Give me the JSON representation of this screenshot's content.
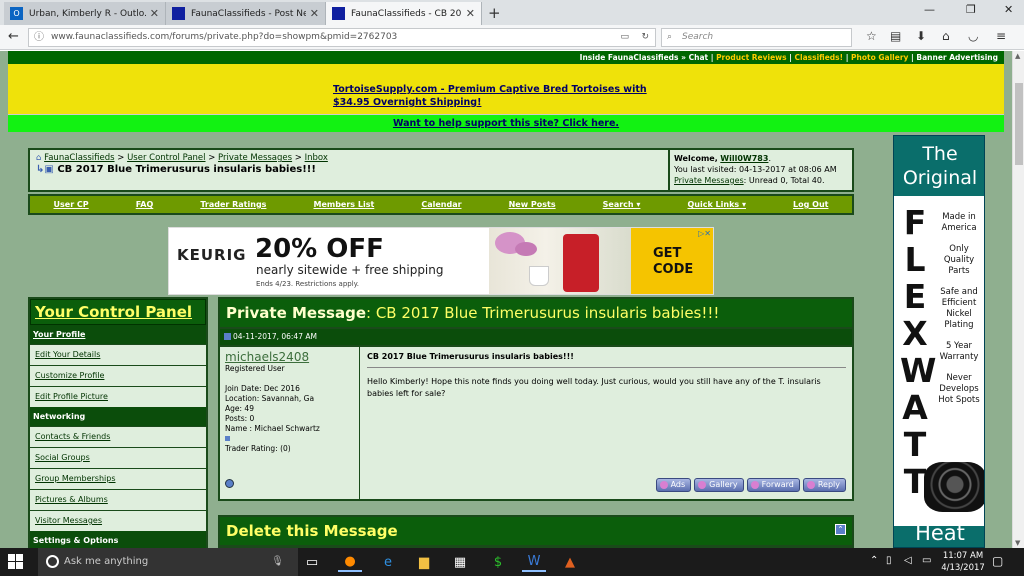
{
  "browser": {
    "tabs": [
      {
        "title": "Urban, Kimberly R - Outlo..."
      },
      {
        "title": "FaunaClassifieds - Post Ne..."
      },
      {
        "title": "FaunaClassifieds - CB 201..."
      }
    ],
    "url": "www.faunaclassifieds.com/forums/private.php?do=showpm&pmid=2762703",
    "search_placeholder": "Search"
  },
  "site": {
    "top_links": {
      "inside": "Inside FaunaClassifieds",
      "chat": "» Chat",
      "reviews": "Product Reviews",
      "classifieds": "Classifieds!",
      "photos": "Photo Gallery",
      "banner": "Banner Advertising"
    },
    "banner_ad": "TortoiseSupply.com - Premium Captive Bred Tortoises with $34.95 Overnight Shipping!",
    "support_link": "Want to help support this site? Click here.",
    "breadcrumb": {
      "site": "FaunaClassifieds",
      "ucp": "User Control Panel",
      "pm": "Private Messages",
      "inbox": "Inbox"
    },
    "page_title": "CB 2017 Blue Trimerusurus insularis babies!!!",
    "welcome": {
      "label": "Welcome,",
      "user": "Will0W783",
      "last_visit": "You last visited: 04-13-2017 at 08:06 AM",
      "pm_link": "Private Messages",
      "pm_counts": ": Unread 0, Total 40."
    },
    "nav": [
      "User CP",
      "FAQ",
      "Trader Ratings",
      "Members List",
      "Calendar",
      "New Posts",
      "Search ▾",
      "Quick Links ▾",
      "Log Out"
    ]
  },
  "ad": {
    "brand": "ΚEURIG",
    "headline": "20% OFF",
    "sub": "nearly sitewide + free shipping",
    "ends": "Ends 4/23. Restrictions apply.",
    "cta_line1": "GET",
    "cta_line2": "CODE"
  },
  "control_panel": {
    "title": "Your Control Panel",
    "sections": [
      {
        "heading": "Your Profile",
        "items": [
          "Edit Your Details",
          "Customize Profile",
          "Edit Profile Picture"
        ]
      },
      {
        "heading": "Networking",
        "items": [
          "Contacts & Friends",
          "Social Groups",
          "Group Memberships",
          "Pictures & Albums",
          "Visitor Messages"
        ]
      },
      {
        "heading": "Settings & Options",
        "items": []
      }
    ]
  },
  "pm": {
    "header_label": "Private Message",
    "header_title": ": CB 2017 Blue Trimerusurus insularis babies!!!",
    "date": "04-11-2017, 06:47 AM",
    "sender": {
      "name": "michaels2408",
      "role": "Registered User",
      "join": "Join Date: Dec 2016",
      "location": "Location: Savannah, Ga",
      "age": "Age: 49",
      "posts": "Posts: 0",
      "name_line": "Name : Michael Schwartz",
      "trader": "Trader Rating: (0)"
    },
    "subject": "CB 2017 Blue Trimerusurus insularis babies!!!",
    "body": "Hello Kimberly! Hope this note finds you doing well today. Just curious, would you still have any of the T. insularis babies left for sale?",
    "buttons": [
      "Ads",
      "Gallery",
      "Forward",
      "Reply"
    ]
  },
  "delete": {
    "title": "Delete this Message"
  },
  "side_ad": {
    "top": "The Original",
    "letters": [
      "F",
      "L",
      "E",
      "X",
      "W",
      "A",
      "T",
      "T"
    ],
    "features": [
      "Made in America",
      "Only Quality Parts",
      "Safe and Efficient Nickel Plating",
      "5 Year Warranty",
      "Never Develops Hot Spots"
    ],
    "bottom": "Heat"
  },
  "taskbar": {
    "search": "Ask me anything",
    "time": "11:07 AM",
    "date": "4/13/2017"
  },
  "colors": {
    "page_bg": "#8faf8f",
    "forum_green": "#0b5e0b",
    "banner_yellow": "#efe20a",
    "support_green": "#12f212"
  }
}
